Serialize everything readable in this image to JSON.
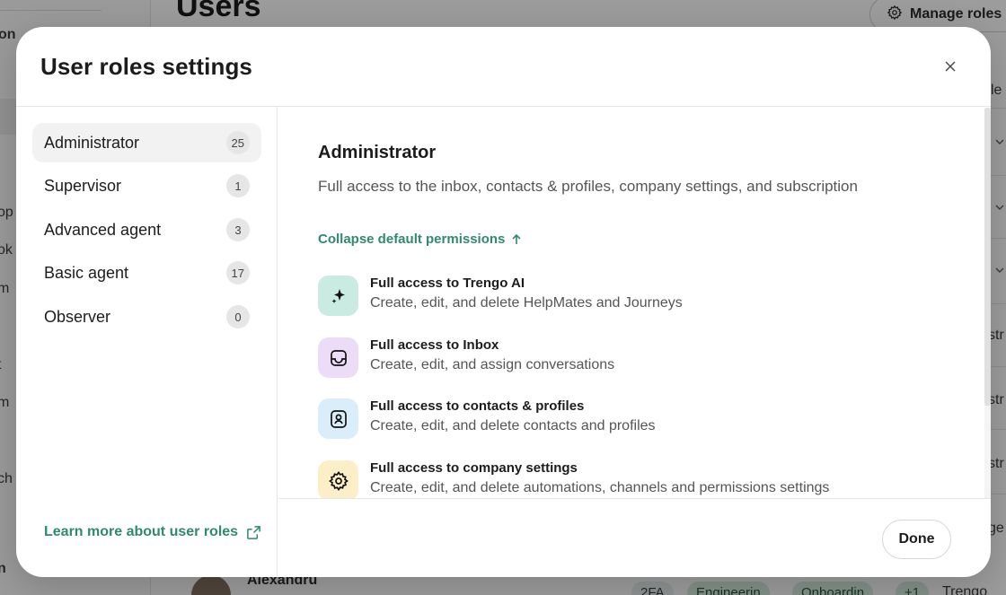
{
  "background": {
    "page_title": "Users",
    "manage_roles_label": "Manage roles",
    "sidebar_fragments": [
      "on",
      "op",
      "ok",
      "m",
      "t",
      "m",
      "ch",
      "n"
    ],
    "right_fragments": [
      "le",
      "str",
      "str",
      "str",
      "ge"
    ],
    "user_row": {
      "name": "Alexandru",
      "pills": [
        "2FA",
        "Engineerin",
        "Onboardin",
        "+1"
      ],
      "team": "Trengo"
    }
  },
  "modal": {
    "title": "User roles settings",
    "close_icon": "close-icon",
    "roles": [
      {
        "label": "Administrator",
        "count": "25",
        "active": true
      },
      {
        "label": "Supervisor",
        "count": "1",
        "active": false
      },
      {
        "label": "Advanced agent",
        "count": "3",
        "active": false
      },
      {
        "label": "Basic agent",
        "count": "17",
        "active": false
      },
      {
        "label": "Observer",
        "count": "0",
        "active": false
      }
    ],
    "learn_more_label": "Learn more about user roles",
    "learn_more_icon": "external-link-icon",
    "selected_role": {
      "name": "Administrator",
      "description": "Full access to the inbox, contacts & profiles, company settings, and subscription",
      "collapse_label": "Collapse default permissions",
      "permissions": [
        {
          "title": "Full access to Trengo AI",
          "subtitle": "Create, edit, and delete HelpMates and Journeys",
          "icon": "sparkle-icon",
          "color": "#c9ebe2"
        },
        {
          "title": "Full access to Inbox",
          "subtitle": "Create, edit, and assign conversations",
          "icon": "inbox-icon",
          "color": "#ecdcf8"
        },
        {
          "title": "Full access to contacts & profiles",
          "subtitle": "Create, edit, and delete contacts and profiles",
          "icon": "contact-icon",
          "color": "#d9eefa"
        },
        {
          "title": "Full access to company settings",
          "subtitle": "Create, edit, and delete automations, channels and permissions settings",
          "icon": "gear-icon",
          "color": "#fcefc8"
        }
      ]
    },
    "done_label": "Done"
  }
}
